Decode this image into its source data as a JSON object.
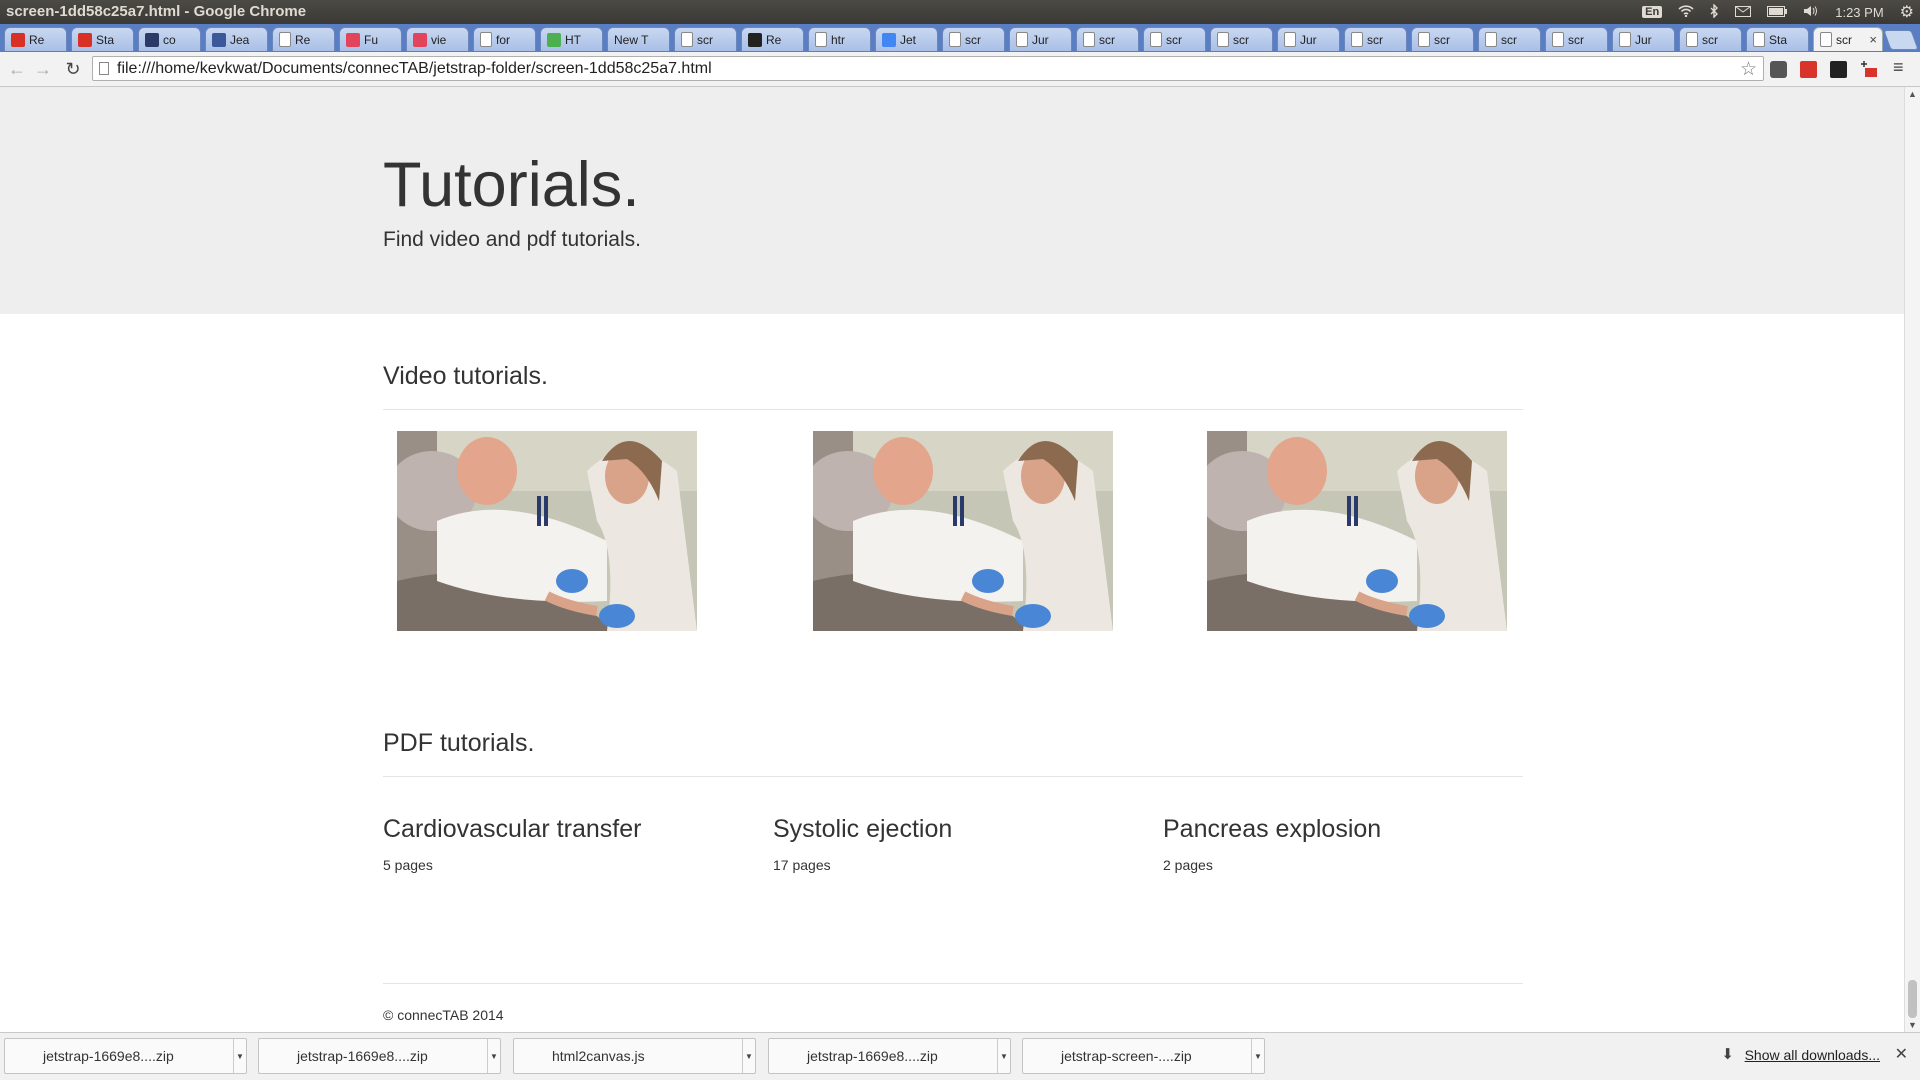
{
  "os": {
    "window_title": "screen-1dd58c25a7.html - Google Chrome",
    "keyboard_layout": "En",
    "clock": "1:23 PM"
  },
  "tabs": [
    {
      "label": "Re",
      "icon": "gmail-icon",
      "color": "#d93025"
    },
    {
      "label": "Sta",
      "icon": "gmail-icon",
      "color": "#d93025"
    },
    {
      "label": "co",
      "icon": "globe-icon",
      "color": "#2b3a67"
    },
    {
      "label": "Jea",
      "icon": "facebook-icon",
      "color": "#3b5998"
    },
    {
      "label": "Re",
      "icon": "page-icon",
      "color": "#ffffff"
    },
    {
      "label": "Fu",
      "icon": "s-icon",
      "color": "#e2455b"
    },
    {
      "label": "vie",
      "icon": "s-icon",
      "color": "#e2455b"
    },
    {
      "label": "for",
      "icon": "page-icon",
      "color": "#ffffff"
    },
    {
      "label": "HT",
      "icon": "w3-icon",
      "color": "#4caf50"
    },
    {
      "label": "New T",
      "icon": "none",
      "color": ""
    },
    {
      "label": "scr",
      "icon": "page-icon",
      "color": "#ffffff"
    },
    {
      "label": "Re",
      "icon": "github-icon",
      "color": "#222222"
    },
    {
      "label": "htr",
      "icon": "page-icon",
      "color": "#ffffff"
    },
    {
      "label": "Jet",
      "icon": "chrome-icon",
      "color": "#4285f4"
    },
    {
      "label": "scr",
      "icon": "page-icon",
      "color": "#ffffff"
    },
    {
      "label": "Jur",
      "icon": "page-icon",
      "color": "#ffffff"
    },
    {
      "label": "scr",
      "icon": "page-icon",
      "color": "#ffffff"
    },
    {
      "label": "scr",
      "icon": "page-icon",
      "color": "#ffffff"
    },
    {
      "label": "scr",
      "icon": "page-icon",
      "color": "#ffffff"
    },
    {
      "label": "Jur",
      "icon": "page-icon",
      "color": "#ffffff"
    },
    {
      "label": "scr",
      "icon": "page-icon",
      "color": "#ffffff"
    },
    {
      "label": "scr",
      "icon": "page-icon",
      "color": "#ffffff"
    },
    {
      "label": "scr",
      "icon": "page-icon",
      "color": "#ffffff"
    },
    {
      "label": "scr",
      "icon": "page-icon",
      "color": "#ffffff"
    },
    {
      "label": "Jur",
      "icon": "page-icon",
      "color": "#ffffff"
    },
    {
      "label": "scr",
      "icon": "page-icon",
      "color": "#ffffff"
    },
    {
      "label": "Sta",
      "icon": "page-icon",
      "color": "#ffffff"
    }
  ],
  "active_tab": {
    "label": "scr",
    "close": "×"
  },
  "toolbar": {
    "url": "file:///home/kevkwat/Documents/connecTAB/jetstrap-folder/screen-1dd58c25a7.html"
  },
  "page": {
    "jumbotron": {
      "title": "Tutorials.",
      "subtitle": "Find video and pdf tutorials."
    },
    "video_section": {
      "title": "Video tutorials.",
      "thumbnails": [
        {
          "icon": "video-thumbnail-image"
        },
        {
          "icon": "video-thumbnail-image"
        },
        {
          "icon": "video-thumbnail-image"
        }
      ]
    },
    "pdf_section": {
      "title": "PDF tutorials.",
      "items": [
        {
          "title": "Cardiovascular transfer",
          "pages": "5 pages"
        },
        {
          "title": "Systolic ejection",
          "pages": "17 pages"
        },
        {
          "title": "Pancreas explosion",
          "pages": "2 pages"
        }
      ]
    },
    "footer": "© connecTAB 2014"
  },
  "downloads": {
    "items": [
      "jetstrap-1669e8....zip",
      "jetstrap-1669e8....zip",
      "html2canvas.js",
      "jetstrap-1669e8....zip",
      "jetstrap-screen-....zip"
    ],
    "show_all": "Show all downloads..."
  }
}
